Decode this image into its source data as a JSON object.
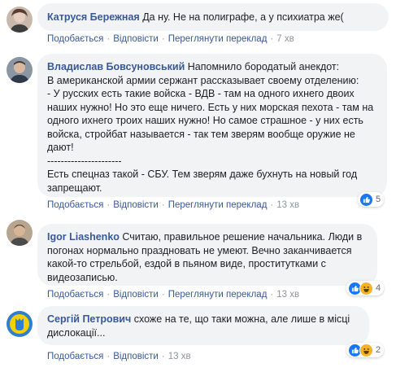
{
  "actions": {
    "like": "Подобається",
    "reply": "Відповісти",
    "translate": "Переглянути переклад"
  },
  "comments": [
    {
      "author": "Катруся Бережная",
      "text": "Да ну. Не на полиграфе, а у психиатра же(",
      "time": "7 хв",
      "has_translate": true
    },
    {
      "author": "Владислав Бовсуновський",
      "text": "Напомнило бородатый анекдот:\nВ американской армии сержант рассказывает своему отделению:\n- У русских есть такие войска - ВДВ - там на одного ихнего двоих наших нужно! Но это еще ничего. Есть у них морская пехота - там на одного ихнего троих наших нужно! Но самое страшное - у них есть войска, стройбат называется - так тем зверям вообще оружие не дают!\n----------------------\nЕсть спецназ такой - СБУ. Тем зверям даже бухнуть на новый год запрещают.",
      "time": "13 хв",
      "has_translate": true,
      "reaction_count": "5"
    },
    {
      "author": "Igor Liashenko",
      "text": "Считаю, правильное решение начальника. Люди в погонах нормально праздновать не умеют. Вечно заканчивается какой-то стрельбой, ездой в пьяном виде, проститутками с видеозаписью.",
      "time": "13 хв",
      "has_translate": true,
      "reaction_count": "4"
    },
    {
      "author": "Сергій Петрович",
      "text": "схоже на те, що таки можна, але лише в місці дислокації...",
      "time": "13 хв",
      "has_translate": false,
      "reaction_count": "2"
    }
  ]
}
